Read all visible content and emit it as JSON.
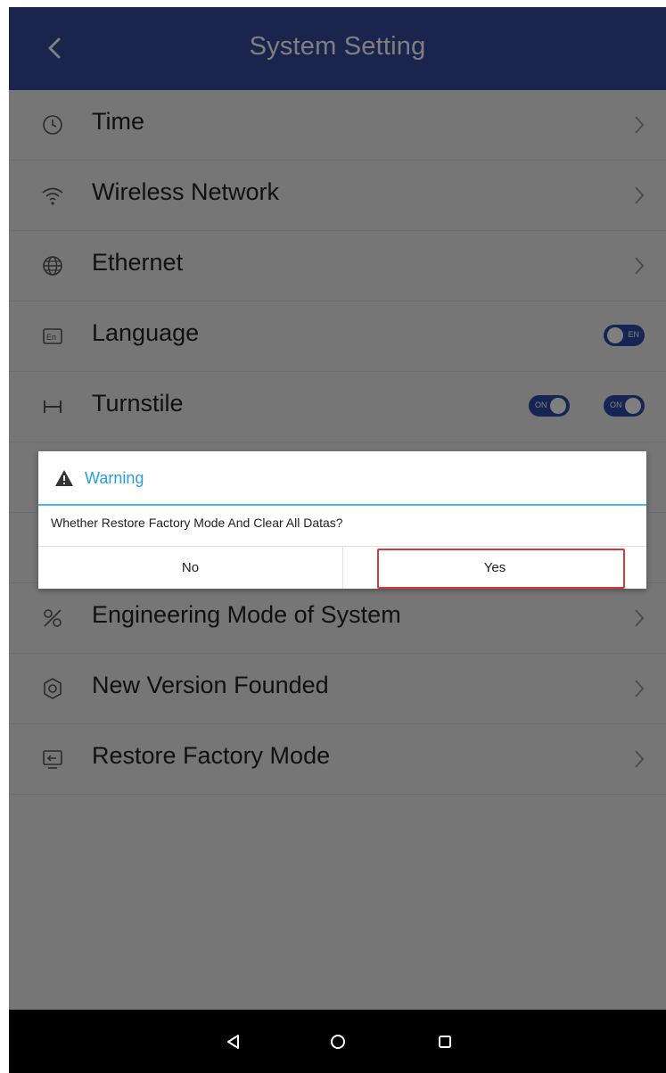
{
  "header": {
    "title": "System Setting",
    "back_icon": "chevron-left-icon"
  },
  "settings": [
    {
      "label": "Time",
      "icon": "clock-icon",
      "control": "chevron"
    },
    {
      "label": "Wireless Network",
      "icon": "wifi-icon",
      "control": "chevron"
    },
    {
      "label": "Ethernet",
      "icon": "globe-icon",
      "control": "chevron"
    },
    {
      "label": "Language",
      "icon": "language-icon",
      "control": "toggle",
      "toggle_text": "EN"
    },
    {
      "label": "Turnstile",
      "icon": "turnstile-icon",
      "control": "two-toggles",
      "toggle_text": "ON"
    },
    {
      "label": "",
      "icon": "",
      "control": "none"
    },
    {
      "label": "",
      "icon": "",
      "control": "none"
    },
    {
      "label": "Engineering Mode of System",
      "icon": "engineering-icon",
      "control": "chevron"
    },
    {
      "label": "New Version Founded",
      "icon": "update-gear-icon",
      "control": "chevron"
    },
    {
      "label": "Restore Factory Mode",
      "icon": "restore-icon",
      "control": "chevron"
    }
  ],
  "dialog": {
    "title": "Warning",
    "message": "Whether Restore Factory Mode And Clear All Datas?",
    "no_label": "No",
    "yes_label": "Yes",
    "highlight_color": "#d33a3a"
  },
  "navbar": {
    "back_icon": "triangle-back-icon",
    "home_icon": "circle-home-icon",
    "recents_icon": "square-recents-icon"
  },
  "colors": {
    "header_bg": "#34489a",
    "toggle_on": "#2f4aa8",
    "dialog_accent": "#2a9ed6"
  }
}
